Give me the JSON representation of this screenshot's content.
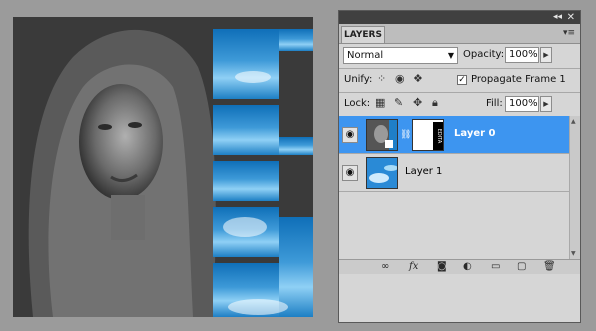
{
  "canvas": {
    "overlay_text": "EDITA",
    "colors": {
      "sky_dark": "#0f6fb8",
      "sky_light": "#8fd0f5",
      "photo_bg": "#2f2f2f"
    }
  },
  "panel": {
    "tab_label": "LAYERS",
    "collapse_glyph": "◂◂",
    "close_glyph": "✕",
    "menu_glyph": "▾≡",
    "blend_mode": "Normal",
    "opacity_label": "Opacity:",
    "opacity_value": "100%",
    "unify_label": "Unify:",
    "propagate_label": "Propagate Frame 1",
    "propagate_checked": "✓",
    "lock_label": "Lock:",
    "fill_label": "Fill:",
    "fill_value": "100%",
    "layers": [
      {
        "name": "Layer 0",
        "selected": true
      },
      {
        "name": "Layer 1",
        "selected": false
      }
    ],
    "footer_icons": [
      "link-icon",
      "fx-icon",
      "mask-icon",
      "adjustment-icon",
      "folder-icon",
      "new-layer-icon",
      "trash-icon"
    ],
    "colors": {
      "selection": "#3d95f0",
      "panel_bg": "#d6d6d6"
    }
  }
}
